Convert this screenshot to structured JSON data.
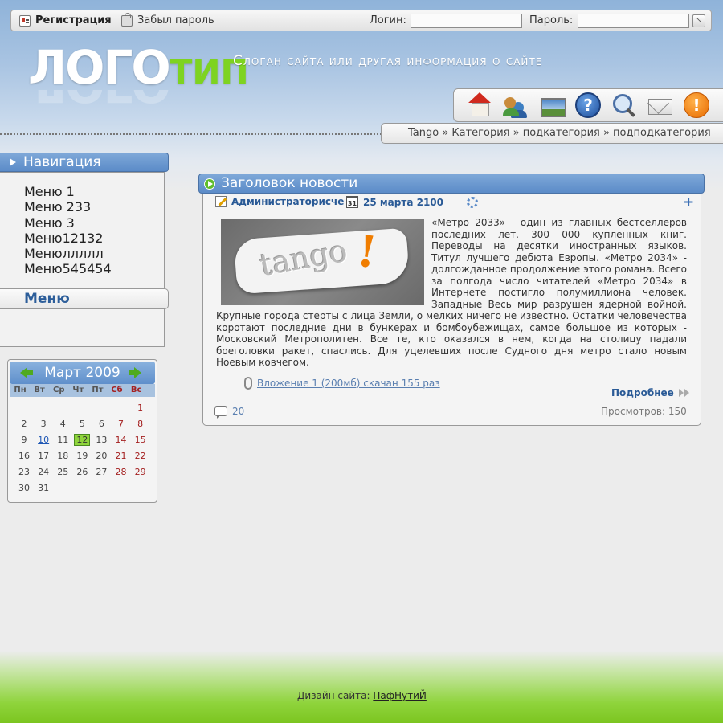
{
  "topbar": {
    "register_label": "Регистрация",
    "forgot_label": "Забыл пароль",
    "login_label": "Логин:",
    "password_label": "Пароль:",
    "login_value": "",
    "password_value": ""
  },
  "header": {
    "logo_part1": "ЛОГО",
    "logo_part2": "ТИП",
    "slogan": "Слоган сайта или другая информация о сайте",
    "icons": [
      "home-icon",
      "users-icon",
      "gallery-icon",
      "help-icon",
      "search-icon",
      "mail-icon",
      "alert-icon"
    ]
  },
  "breadcrumb": {
    "text": "Tango » Категория » подкатегория » подподкатегория"
  },
  "sidebar": {
    "nav_title": "Навигация",
    "menu_items": [
      "Меню 1",
      "Меню 233",
      "Меню 3",
      "Меню12132",
      "Менюллллл",
      "Меню545454"
    ],
    "menu_title": "Меню"
  },
  "calendar": {
    "title": "Март 2009",
    "weekdays": [
      "Пн",
      "Вт",
      "Ср",
      "Чт",
      "Пт",
      "Сб",
      "Вс"
    ],
    "weeks": [
      [
        "",
        "",
        "",
        "",
        "",
        "",
        "1"
      ],
      [
        "2",
        "3",
        "4",
        "5",
        "6",
        "7",
        "8"
      ],
      [
        "9",
        "10",
        "11",
        "12",
        "13",
        "14",
        "15"
      ],
      [
        "16",
        "17",
        "18",
        "19",
        "20",
        "21",
        "22"
      ],
      [
        "23",
        "24",
        "25",
        "26",
        "27",
        "28",
        "29"
      ],
      [
        "30",
        "31",
        "",
        "",
        "",
        "",
        ""
      ]
    ],
    "today": "12",
    "linked_day": "10"
  },
  "news": {
    "title": "Заголовок новости",
    "author": "Администраторисче",
    "date": "25 марта 2100",
    "calendar_icon_label": "31",
    "image_text": "tango",
    "image_mark": "!",
    "body": " «Метро 2033» - один из главных бестселлеров последних лет. 300 000 купленных книг. Переводы на десятки иностранных языков. Титул лучшего дебюта Европы. «Метро 2034» - долгожданное продолжение этого романа. Всего за полгода число читателей «Метро 2034» в Интернете постигло полумиллиона человек. Западные Весь мир разрушен ядерной войной. Крупные города стерты с лица Земли, о мелких ничего не известно. Остатки человечества коротают последние дни в бункерах и бомбоубежищах, самое большое из которых - Московский Метрополитен. Все те, кто оказался в нем, когда на столицу падали боеголовки ракет, спаслись. Для уцелевших после Судного дня метро стало новым Ноевым ковчегом.",
    "attachment": "Вложение 1 (200мб) скачан 155 раз",
    "more_label": "Подробнее",
    "comments_count": "20",
    "views_label": "Просмотров: 150"
  },
  "footer": {
    "label": "Дизайн сайта:",
    "author_link": "ПафНутиЙ"
  }
}
